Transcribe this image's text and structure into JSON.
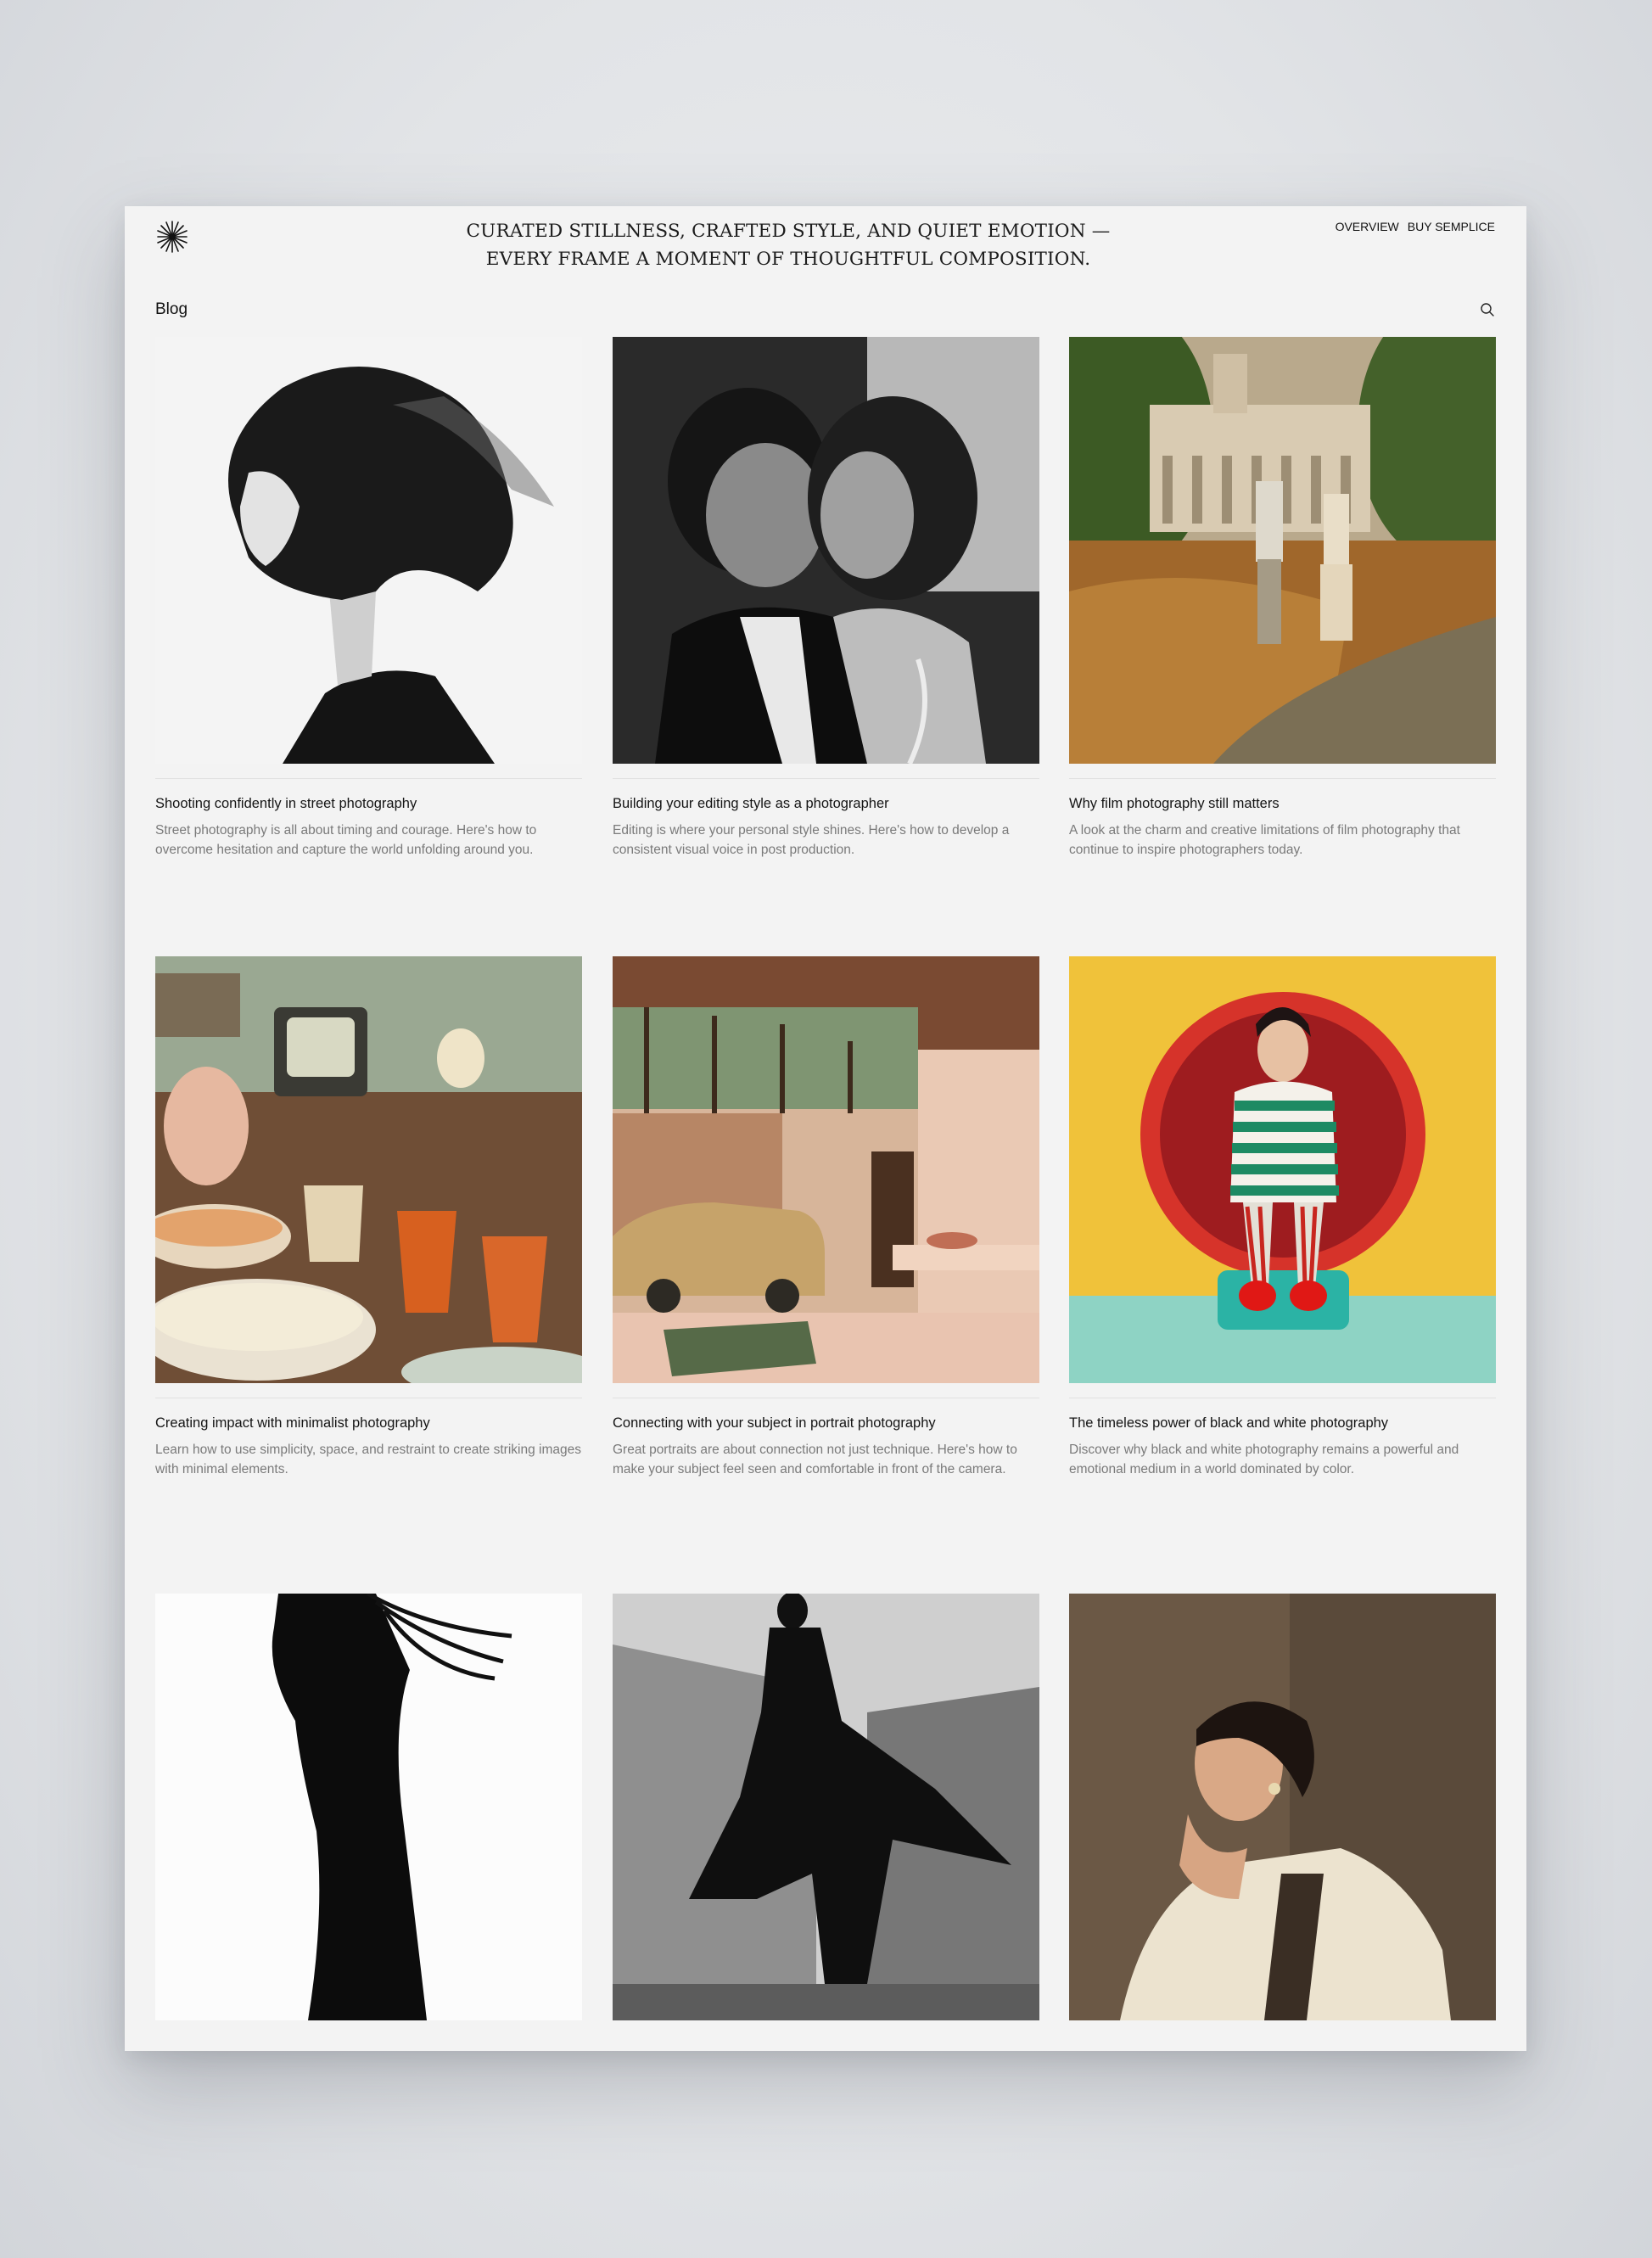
{
  "header": {
    "logo_icon": "asterisk-star-icon",
    "tagline": "CURATED STILLNESS, CRAFTED STYLE, AND QUIET EMOTION — EVERY FRAME A MOMENT OF THOUGHTFUL COMPOSITION.",
    "nav": {
      "overview": "OVERVIEW",
      "buy": "BUY SEMPLICE"
    }
  },
  "section": {
    "title": "Blog",
    "search_icon": "search-icon"
  },
  "posts": [
    {
      "title": "Shooting confidently in street photography",
      "description": "Street photography is all about timing and courage. Here's how to overcome hesitation and capture the world unfolding around you."
    },
    {
      "title": "Building your editing style as a photographer",
      "description": "Editing is where your personal style shines. Here's how to develop a consistent visual voice in post production."
    },
    {
      "title": "Why film photography still matters",
      "description": "A look at the charm and creative limitations of film photography that continue to inspire photographers today."
    },
    {
      "title": "Creating impact with minimalist photography",
      "description": "Learn how to use simplicity, space, and restraint to create striking images with minimal elements."
    },
    {
      "title": "Connecting with your subject in portrait photography",
      "description": "Great portraits are about connection not just technique. Here's how to make your subject feel seen and comfortable in front of the camera."
    },
    {
      "title": "The timeless power of black and white photography",
      "description": "Discover why black and white photography remains a powerful and emotional medium in a world dominated by color."
    },
    {
      "title": "",
      "description": ""
    },
    {
      "title": "",
      "description": ""
    },
    {
      "title": "",
      "description": ""
    }
  ]
}
